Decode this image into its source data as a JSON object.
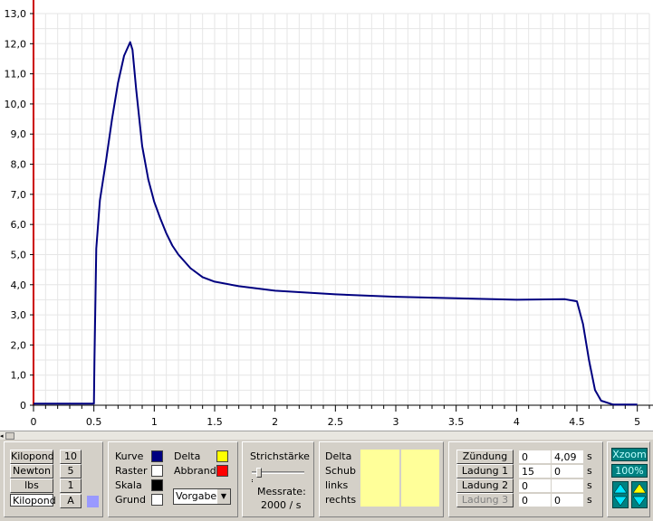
{
  "chart_data": {
    "type": "line",
    "xlabel": "",
    "ylabel": "",
    "xlim": [
      0,
      5.1
    ],
    "ylim": [
      0,
      13.0
    ],
    "x_ticks": [
      0,
      0.5,
      1,
      1.5,
      2,
      2.5,
      3,
      3.5,
      4,
      4.5,
      5
    ],
    "x_tick_labels": [
      "0",
      "0.5",
      "1",
      "1.5",
      "2",
      "2.5",
      "3",
      "3.5",
      "4",
      "4.5",
      "5"
    ],
    "y_ticks": [
      0,
      1,
      2,
      3,
      4,
      5,
      6,
      7,
      8,
      9,
      10,
      11,
      12,
      13
    ],
    "y_tick_labels": [
      "0",
      "1,0",
      "2,0",
      "3,0",
      "4,0",
      "5,0",
      "6,0",
      "7,0",
      "8,0",
      "9,0",
      "10,0",
      "11,0",
      "12,0",
      "13,0"
    ],
    "grid": true,
    "line_color": "#000080",
    "axis_color": "#cc0000",
    "series": [
      {
        "x": [
          0.0,
          0.3,
          0.5,
          0.505,
          0.52,
          0.55,
          0.6,
          0.65,
          0.7,
          0.75,
          0.8,
          0.82,
          0.85,
          0.9,
          0.95,
          1.0,
          1.05,
          1.1,
          1.15,
          1.2,
          1.3,
          1.4,
          1.5,
          1.7,
          2.0,
          2.5,
          3.0,
          3.5,
          4.0,
          4.4,
          4.5,
          4.55,
          4.6,
          4.65,
          4.7,
          4.8,
          5.0
        ],
        "y": [
          0.05,
          0.05,
          0.05,
          1.5,
          5.2,
          6.8,
          8.1,
          9.5,
          10.7,
          11.6,
          12.05,
          11.8,
          10.5,
          8.6,
          7.5,
          6.75,
          6.2,
          5.7,
          5.3,
          5.0,
          4.55,
          4.25,
          4.1,
          3.95,
          3.8,
          3.68,
          3.6,
          3.55,
          3.5,
          3.52,
          3.45,
          2.7,
          1.5,
          0.5,
          0.15,
          0.02,
          0.02
        ]
      }
    ]
  },
  "panel": {
    "units": {
      "buttons": [
        "Kilopond",
        "Newton",
        "lbs"
      ],
      "current": "Kilopond",
      "scale_buttons": [
        "10",
        "5",
        "1",
        "A"
      ],
      "color_hint": "#9999ff"
    },
    "colors": {
      "items": [
        {
          "label": "Kurve",
          "color": "#000080"
        },
        {
          "label": "Raster",
          "color": "#ffffff"
        },
        {
          "label": "Skala",
          "color": "#000000"
        },
        {
          "label": "Grund",
          "color": "#ffffff"
        }
      ],
      "delta_label": "Delta",
      "delta_color": "#ffff00",
      "abbrand_label": "Abbrand",
      "abbrand_color": "#ff0000",
      "dropdown_value": "Vorgabe"
    },
    "stroke": {
      "label": "Strichstärke",
      "slider_value": 0.1,
      "rate_label": "Messrate:",
      "rate_value": "2000 / s"
    },
    "measures": {
      "labels": [
        "Delta",
        "Schub",
        "links",
        "rechts"
      ]
    },
    "charges": {
      "rows": [
        {
          "button": "Zündung",
          "v1": "0",
          "v2": "4,09",
          "unit": "s",
          "disabled": false
        },
        {
          "button": "Ladung 1",
          "v1": "15",
          "v2": "0",
          "unit": "s",
          "disabled": false
        },
        {
          "button": "Ladung 2",
          "v1": "0",
          "v2": "",
          "unit": "s",
          "disabled": false
        },
        {
          "button": "Ladung 3",
          "v1": "0",
          "v2": "0",
          "unit": "s",
          "disabled": true
        }
      ]
    },
    "zoom": {
      "xzoom_label": "Xzoom",
      "percent": "100%"
    }
  }
}
